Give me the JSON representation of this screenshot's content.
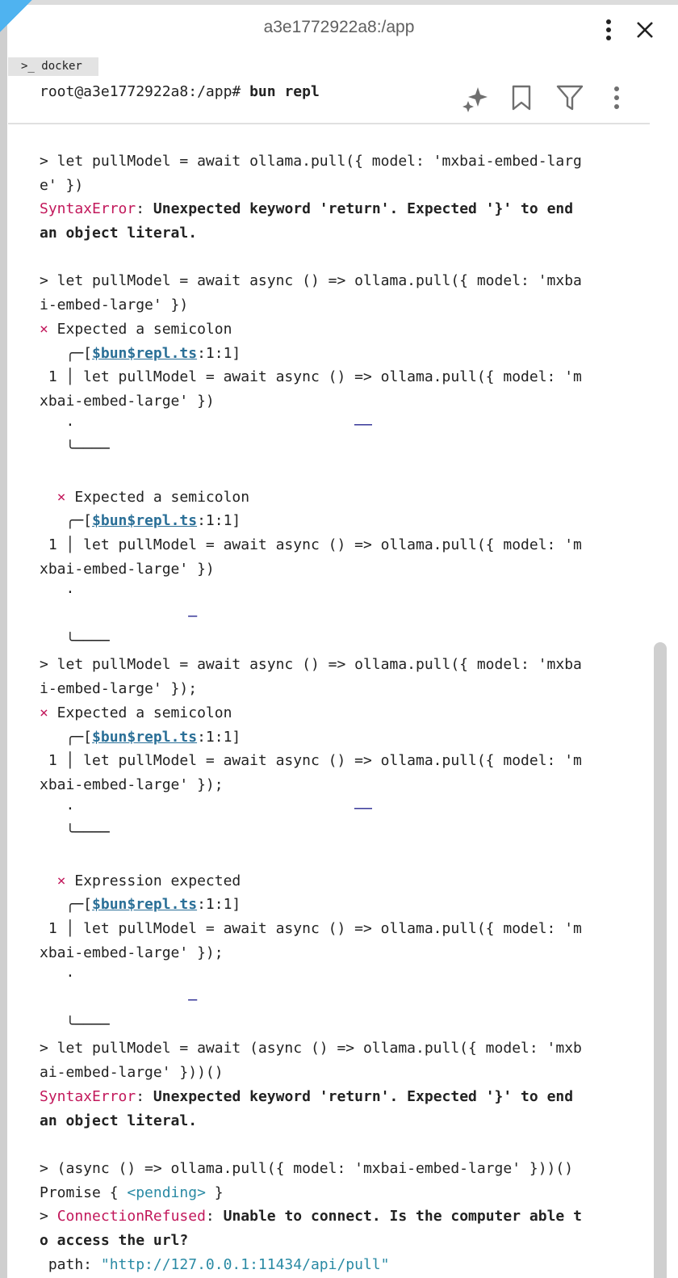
{
  "window": {
    "title": "a3e1772922a8:/app",
    "more_icon": "⋮",
    "close_icon": "✕"
  },
  "tab": {
    "label": ">_ docker"
  },
  "header": {
    "prompt": "root@a3e1772922a8:/app# ",
    "command": "bun repl"
  },
  "toolbar": {
    "icons": [
      "sparkle-icon",
      "bookmark-icon",
      "filter-icon",
      "more-vert-icon"
    ]
  },
  "terminal": {
    "lines": [
      {
        "segs": [
          {
            "t": "> let pullModel = await ollama.pull({ model: 'mxbai-embed-larg"
          }
        ]
      },
      {
        "segs": [
          {
            "t": "e' })"
          }
        ]
      },
      {
        "segs": [
          {
            "t": "SyntaxError",
            "c": "err"
          },
          {
            "t": ": "
          },
          {
            "t": "Unexpected keyword 'return'. Expected '}' to end",
            "c": "bold"
          }
        ]
      },
      {
        "segs": [
          {
            "t": "an object literal.",
            "c": "bold"
          }
        ]
      },
      {
        "segs": [
          {
            "t": ""
          }
        ]
      },
      {
        "segs": [
          {
            "t": "> let pullModel = await async () => ollama.pull({ model: 'mxba"
          }
        ]
      },
      {
        "segs": [
          {
            "t": "i-embed-large' })"
          }
        ]
      },
      {
        "segs": [
          {
            "t": "×",
            "c": "err"
          },
          {
            "t": " Expected a semicolon"
          }
        ]
      },
      {
        "segs": [
          {
            "t": "   ╭─["
          },
          {
            "t": "$bun$repl.ts",
            "c": "link"
          },
          {
            "t": ":1:1]"
          }
        ]
      },
      {
        "segs": [
          {
            "t": " 1 │ let pullModel = await async () => ollama.pull({ model: 'm"
          }
        ]
      },
      {
        "segs": [
          {
            "t": "xbai-embed-large' })"
          }
        ]
      },
      {
        "segs": [
          {
            "t": "   ·                                ",
            "c": ""
          },
          {
            "t": "──",
            "c": "underline-mark"
          }
        ]
      },
      {
        "segs": [
          {
            "t": "   ╰────"
          }
        ]
      },
      {
        "segs": [
          {
            "t": ""
          }
        ]
      },
      {
        "segs": [
          {
            "t": "  ×",
            "c": "err"
          },
          {
            "t": " Expected a semicolon"
          }
        ]
      },
      {
        "segs": [
          {
            "t": "   ╭─["
          },
          {
            "t": "$bun$repl.ts",
            "c": "link"
          },
          {
            "t": ":1:1]"
          }
        ]
      },
      {
        "segs": [
          {
            "t": " 1 │ let pullModel = await async () => ollama.pull({ model: 'm"
          }
        ]
      },
      {
        "segs": [
          {
            "t": "xbai-embed-large' })"
          }
        ]
      },
      {
        "segs": [
          {
            "t": "   ·"
          }
        ]
      },
      {
        "segs": [
          {
            "t": "                 "
          },
          {
            "t": "─",
            "c": "underline-mark"
          }
        ]
      },
      {
        "segs": [
          {
            "t": "   ╰────"
          }
        ]
      },
      {
        "segs": [
          {
            "t": "> let pullModel = await async () => ollama.pull({ model: 'mxba"
          }
        ]
      },
      {
        "segs": [
          {
            "t": "i-embed-large' });"
          }
        ]
      },
      {
        "segs": [
          {
            "t": "×",
            "c": "err"
          },
          {
            "t": " Expected a semicolon"
          }
        ]
      },
      {
        "segs": [
          {
            "t": "   ╭─["
          },
          {
            "t": "$bun$repl.ts",
            "c": "link"
          },
          {
            "t": ":1:1]"
          }
        ]
      },
      {
        "segs": [
          {
            "t": " 1 │ let pullModel = await async () => ollama.pull({ model: 'm"
          }
        ]
      },
      {
        "segs": [
          {
            "t": "xbai-embed-large' });"
          }
        ]
      },
      {
        "segs": [
          {
            "t": "   ·                                ",
            "c": ""
          },
          {
            "t": "──",
            "c": "underline-mark"
          }
        ]
      },
      {
        "segs": [
          {
            "t": "   ╰────"
          }
        ]
      },
      {
        "segs": [
          {
            "t": ""
          }
        ]
      },
      {
        "segs": [
          {
            "t": "  ×",
            "c": "err"
          },
          {
            "t": " Expression expected"
          }
        ]
      },
      {
        "segs": [
          {
            "t": "   ╭─["
          },
          {
            "t": "$bun$repl.ts",
            "c": "link"
          },
          {
            "t": ":1:1]"
          }
        ]
      },
      {
        "segs": [
          {
            "t": " 1 │ let pullModel = await async () => ollama.pull({ model: 'm"
          }
        ]
      },
      {
        "segs": [
          {
            "t": "xbai-embed-large' });"
          }
        ]
      },
      {
        "segs": [
          {
            "t": "   ·"
          }
        ]
      },
      {
        "segs": [
          {
            "t": "                 "
          },
          {
            "t": "─",
            "c": "underline-mark"
          }
        ]
      },
      {
        "segs": [
          {
            "t": "   ╰────"
          }
        ]
      },
      {
        "segs": [
          {
            "t": "> let pullModel = await (async () => ollama.pull({ model: 'mxb"
          }
        ]
      },
      {
        "segs": [
          {
            "t": "ai-embed-large' }))()"
          }
        ]
      },
      {
        "segs": [
          {
            "t": "SyntaxError",
            "c": "err"
          },
          {
            "t": ": "
          },
          {
            "t": "Unexpected keyword 'return'. Expected '}' to end",
            "c": "bold"
          }
        ]
      },
      {
        "segs": [
          {
            "t": "an object literal.",
            "c": "bold"
          }
        ]
      },
      {
        "segs": [
          {
            "t": ""
          }
        ]
      },
      {
        "segs": [
          {
            "t": "> (async () => ollama.pull({ model: 'mxbai-embed-large' }))()"
          }
        ]
      },
      {
        "segs": [
          {
            "t": "Promise { "
          },
          {
            "t": "<pending>",
            "c": "str"
          },
          {
            "t": " }"
          }
        ]
      },
      {
        "segs": [
          {
            "t": "> "
          },
          {
            "t": "ConnectionRefused",
            "c": "err"
          },
          {
            "t": ": "
          },
          {
            "t": "Unable to connect. Is the computer able t",
            "c": "bold"
          }
        ]
      },
      {
        "segs": [
          {
            "t": "o access the url?",
            "c": "bold"
          }
        ]
      },
      {
        "segs": [
          {
            "t": " path: "
          },
          {
            "t": "\"http://127.0.0.1:11434/api/pull\"",
            "c": "str"
          }
        ]
      }
    ]
  }
}
